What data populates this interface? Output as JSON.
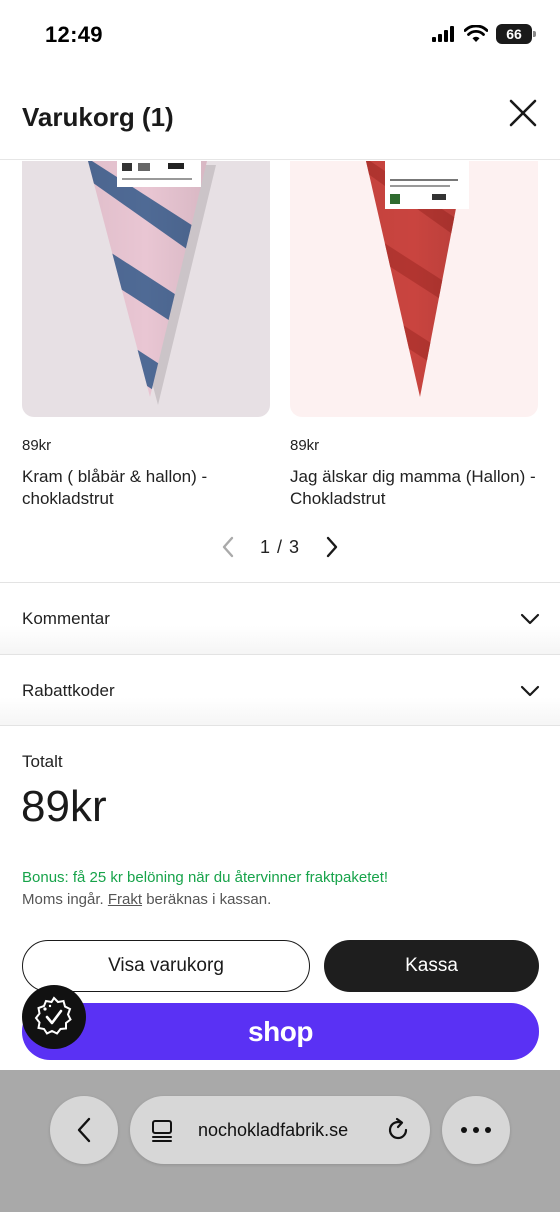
{
  "status_bar": {
    "time": "12:49",
    "battery": "66",
    "icons": [
      "signal-icon",
      "wifi-icon",
      "battery-icon"
    ]
  },
  "header": {
    "title": "Varukorg (1)",
    "close_icon": "close-icon"
  },
  "recommendations": {
    "items": [
      {
        "price": "89kr",
        "name": "Kram ( blåbär & hallon) - chokladstrut"
      },
      {
        "price": "89kr",
        "name": "Jag älskar dig mamma (Hallon) - Chokladstrut"
      }
    ],
    "pager": {
      "text": "1 / 3"
    }
  },
  "accordions": [
    {
      "label": "Kommentar"
    },
    {
      "label": "Rabattkoder"
    }
  ],
  "summary": {
    "total_label": "Totalt",
    "total_value": "89kr",
    "bonus": "Bonus: få 25 kr belöning när du återvinner fraktpaketet!",
    "tax_before": "Moms ingår.",
    "tax_link": "Frakt",
    "tax_after": "beräknas i kassan."
  },
  "buttons": {
    "view_cart": "Visa varukorg",
    "checkout": "Kassa",
    "shop_pay": "shop"
  },
  "colors": {
    "bonus_green": "#17a34a",
    "shop_purple": "#5a31f4",
    "checkout_black": "#1e1e1e"
  },
  "browser": {
    "url": "nochokladfabrik.se"
  }
}
